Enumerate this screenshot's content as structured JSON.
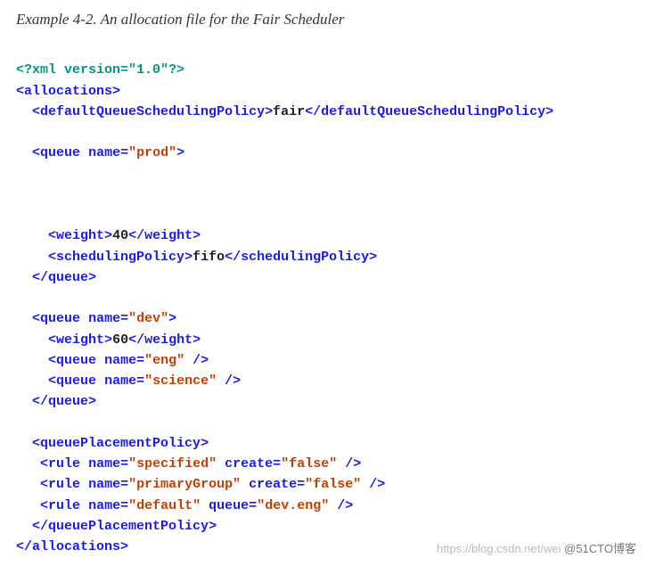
{
  "caption": "Example 4-2. An allocation file for the Fair Scheduler",
  "xml": {
    "declaration": "<?xml version=\"1.0\"?>",
    "root": "allocations",
    "defaultPolicyTag": "defaultQueueSchedulingPolicy",
    "defaultPolicyValue": "fair",
    "queue1": {
      "tag": "queue",
      "nameAttr": "name",
      "nameVal": "prod",
      "weightTag": "weight",
      "weightVal": "40",
      "schedPolicyTag": "schedulingPolicy",
      "schedPolicyVal": "fifo"
    },
    "queue2": {
      "tag": "queue",
      "nameAttr": "name",
      "nameVal": "dev",
      "weightTag": "weight",
      "weightVal": "60",
      "childA": {
        "nameAttr": "name",
        "nameVal": "eng"
      },
      "childB": {
        "nameAttr": "name",
        "nameVal": "science"
      }
    },
    "placement": {
      "tag": "queuePlacementPolicy",
      "ruleTag": "rule",
      "rules": [
        {
          "nameAttr": "name",
          "nameVal": "specified",
          "attr2": "create",
          "val2": "false"
        },
        {
          "nameAttr": "name",
          "nameVal": "primaryGroup",
          "attr2": "create",
          "val2": "false"
        },
        {
          "nameAttr": "name",
          "nameVal": "default",
          "attr2": "queue",
          "val2": "dev.eng"
        }
      ]
    }
  },
  "watermark": {
    "faint": "https://blog.csdn.net/wei",
    "dark": "@51CTO博客"
  }
}
